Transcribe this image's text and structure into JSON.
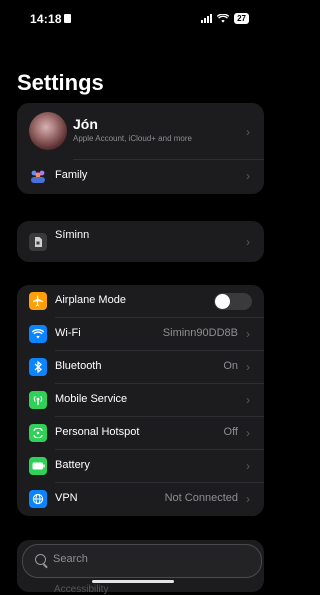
{
  "status_bar": {
    "time": "14:18",
    "battery": "27"
  },
  "title": "Settings",
  "profile": {
    "name": "Jón",
    "subtitle": "Apple Account, iCloud+ and more"
  },
  "family": {
    "label": "Family"
  },
  "carrier": {
    "label": "Síminn"
  },
  "network_rows": [
    {
      "label": "Airplane Mode",
      "value": "",
      "toggle_on": false
    },
    {
      "label": "Wi-Fi",
      "value": "Siminn90DD8B"
    },
    {
      "label": "Bluetooth",
      "value": "On"
    },
    {
      "label": "Mobile Service",
      "value": ""
    },
    {
      "label": "Personal Hotspot",
      "value": "Off"
    },
    {
      "label": "Battery",
      "value": ""
    },
    {
      "label": "VPN",
      "value": "Not Connected"
    }
  ],
  "peek_row": {
    "label": "Accessibility"
  },
  "search": {
    "placeholder": "Search"
  },
  "colors": {
    "airplane": "#ff9f0a",
    "wifi": "#0a84ff",
    "bluetooth": "#0a84ff",
    "mobile": "#30d158",
    "hotspot": "#30d158",
    "battery": "#30d158",
    "vpn": "#0a84ff"
  }
}
